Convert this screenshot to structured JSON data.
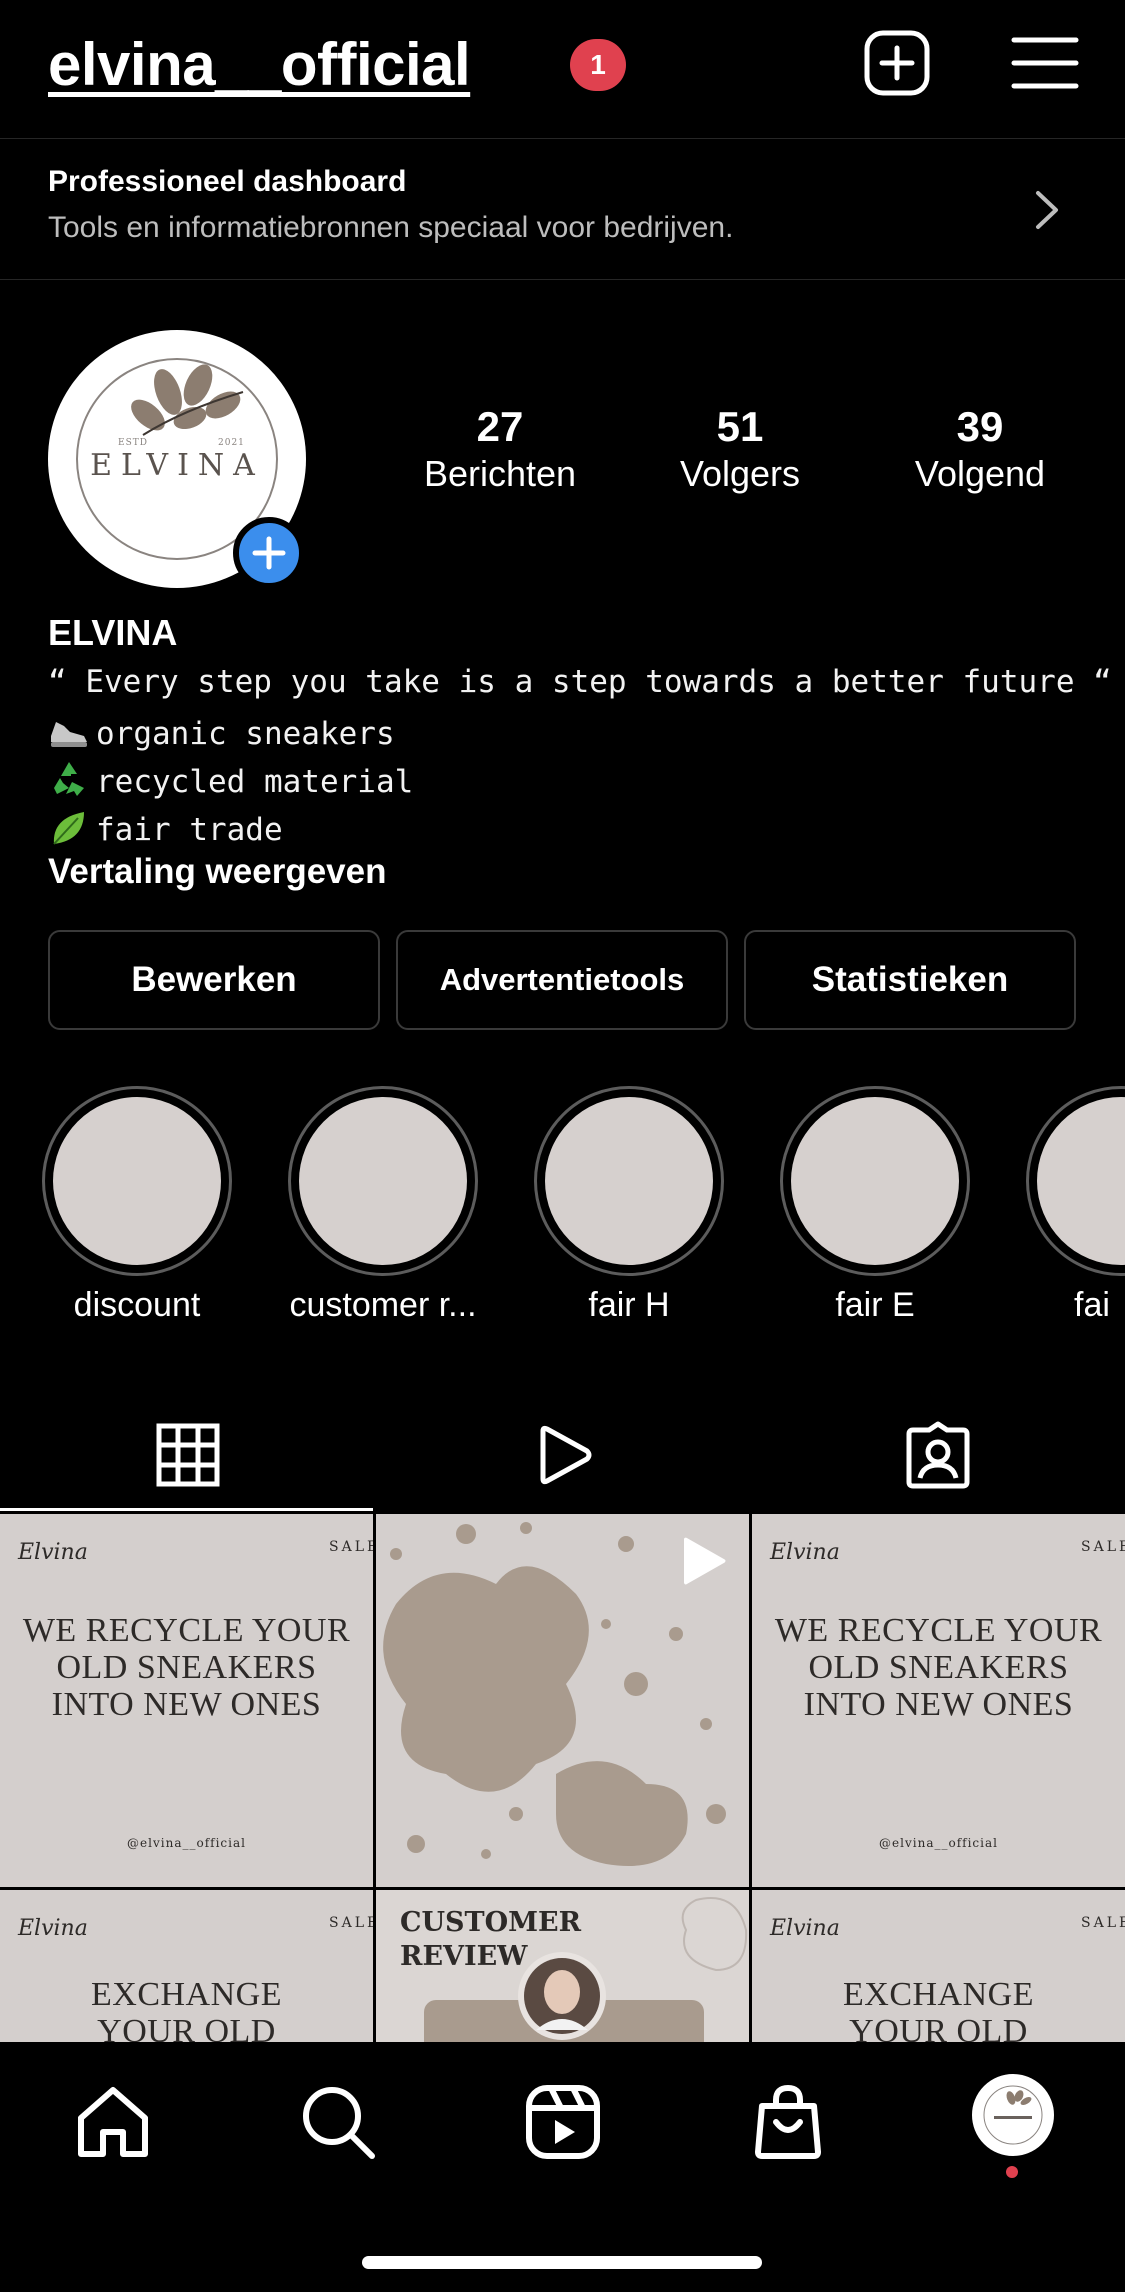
{
  "header": {
    "username": "elvina__official",
    "notification_count": "1",
    "plus_icon": "add-square-icon",
    "menu_icon": "hamburger-menu-icon"
  },
  "dashboard": {
    "title": "Professioneel dashboard",
    "subtitle": "Tools en informatiebronnen speciaal voor bedrijven."
  },
  "profile": {
    "avatar_logo": {
      "estd": "ESTD",
      "year": "2021",
      "name": "ELVINA"
    },
    "stats": [
      {
        "value": "27",
        "label": "Berichten"
      },
      {
        "value": "51",
        "label": "Volgers"
      },
      {
        "value": "39",
        "label": "Volgend"
      }
    ],
    "display_name": "ELVINA",
    "bio": [
      {
        "icon": "",
        "text": "“ Every step you take is a step towards a better future “"
      },
      {
        "icon": "sneaker-icon",
        "text": "organic sneakers"
      },
      {
        "icon": "recycle-icon",
        "text": "recycled material"
      },
      {
        "icon": "leaf-icon",
        "text": "fair trade"
      }
    ],
    "translate_label": "Vertaling weergeven"
  },
  "actions": {
    "edit": "Bewerken",
    "ad_tools": "Advertentietools",
    "insights": "Statistieken"
  },
  "highlights": [
    {
      "label": "discount"
    },
    {
      "label": "customer r..."
    },
    {
      "label": "fair H"
    },
    {
      "label": "fair E"
    },
    {
      "label": "fai"
    }
  ],
  "tabs": [
    {
      "name": "grid-icon",
      "active": true
    },
    {
      "name": "reels-play-icon",
      "active": false
    },
    {
      "name": "tagged-person-icon",
      "active": false
    }
  ],
  "posts": [
    {
      "type": "text",
      "brand": "Elvina",
      "sale": "SALE",
      "text": "We recycle your old sneakers into new ones",
      "handle": "@elvina__official"
    },
    {
      "type": "splatter",
      "reel_icon": "play-icon"
    },
    {
      "type": "text",
      "brand": "Elvina",
      "sale": "SALE",
      "text": "We recycle your old sneakers into new ones",
      "handle": "@elvina__official"
    },
    {
      "type": "text",
      "brand": "Elvina",
      "sale": "SALE",
      "text": "Exchange your old"
    },
    {
      "type": "review",
      "text": "Customer review"
    },
    {
      "type": "text",
      "brand": "Elvina",
      "sale": "SALE",
      "text": "Exchange your old"
    }
  ],
  "bottom_nav": [
    {
      "name": "home-icon"
    },
    {
      "name": "search-icon"
    },
    {
      "name": "reels-icon"
    },
    {
      "name": "shop-bag-icon"
    },
    {
      "name": "profile-avatar"
    }
  ],
  "colors": {
    "background": "#000000",
    "accent_blue": "#3b8eed",
    "badge_red": "#e0414f",
    "tile_bg": "#d4cfcd",
    "splatter": "#a99b8e"
  }
}
